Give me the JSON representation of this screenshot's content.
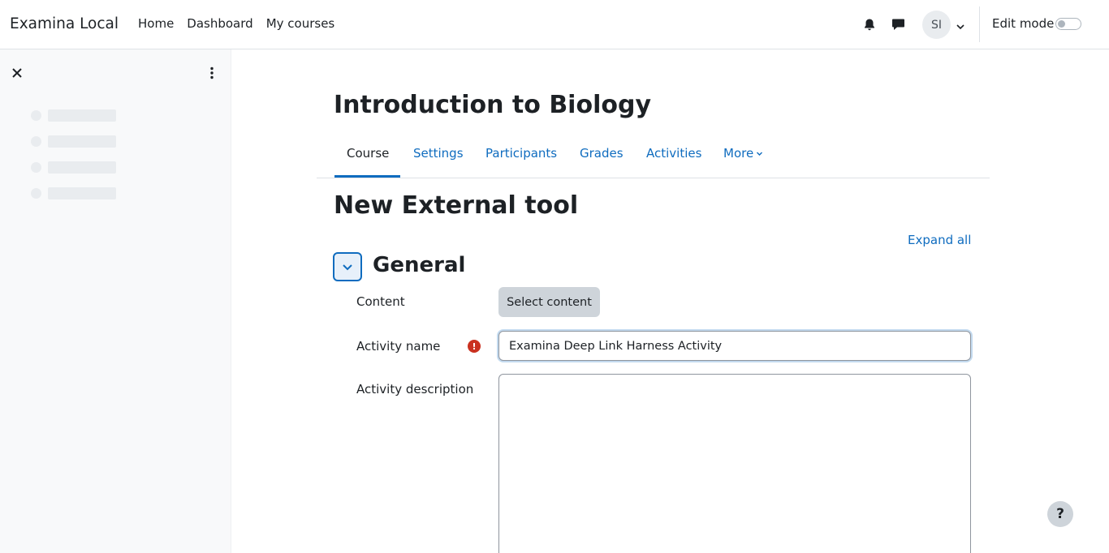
{
  "navbar": {
    "brand": "Examina Local",
    "links": [
      "Home",
      "Dashboard",
      "My courses"
    ],
    "avatar_initials": "SI",
    "edit_mode_label": "Edit mode",
    "edit_mode_on": false
  },
  "course": {
    "title": "Introduction to Biology",
    "tabs": [
      {
        "label": "Course",
        "active": true
      },
      {
        "label": "Settings",
        "active": false
      },
      {
        "label": "Participants",
        "active": false
      },
      {
        "label": "Grades",
        "active": false
      },
      {
        "label": "Activities",
        "active": false
      },
      {
        "label": "More",
        "active": false
      }
    ]
  },
  "page": {
    "heading": "New External tool",
    "expand_all": "Expand all"
  },
  "form": {
    "section_title": "General",
    "content_label": "Content",
    "select_content_button": "Select content",
    "activity_name_label": "Activity name",
    "activity_name_value": "Examina Deep Link Harness Activity",
    "required_icon": "!",
    "activity_description_label": "Activity description",
    "activity_description_value": ""
  },
  "help": {
    "label": "?"
  },
  "colors": {
    "link": "#0f6cbf",
    "text": "#1d2125",
    "required": "#ca3120",
    "drawer_bg": "#f8f9fa"
  }
}
